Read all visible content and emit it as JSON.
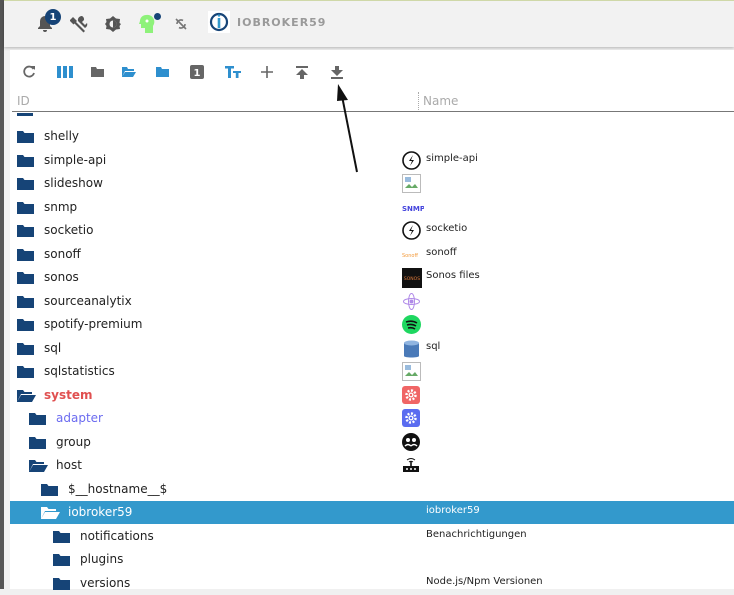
{
  "topbar": {
    "notification_count": "1",
    "host": "IOBROKER59"
  },
  "toolbar": {
    "items": [
      "refresh",
      "columns",
      "folder-closed",
      "folder-open",
      "folder-blue",
      "number-1",
      "text-size",
      "add",
      "upload",
      "download"
    ]
  },
  "header": {
    "id": "ID",
    "name": "Name"
  },
  "rows": [
    {
      "id": "shelly",
      "level": 0,
      "open": false,
      "name": "",
      "icon": ""
    },
    {
      "id": "simple-api",
      "level": 0,
      "open": false,
      "name": "simple-api",
      "icon": "bolt"
    },
    {
      "id": "slideshow",
      "level": 0,
      "open": false,
      "name": "",
      "icon": "broken-image"
    },
    {
      "id": "snmp",
      "level": 0,
      "open": false,
      "name": "",
      "icon": "snmp"
    },
    {
      "id": "socketio",
      "level": 0,
      "open": false,
      "name": "socketio",
      "icon": "bolt"
    },
    {
      "id": "sonoff",
      "level": 0,
      "open": false,
      "name": "sonoff",
      "icon": "sonoff"
    },
    {
      "id": "sonos",
      "level": 0,
      "open": false,
      "name": "Sonos files",
      "icon": "sonos"
    },
    {
      "id": "sourceanalytix",
      "level": 0,
      "open": false,
      "name": "",
      "icon": "atom"
    },
    {
      "id": "spotify-premium",
      "level": 0,
      "open": false,
      "name": "",
      "icon": "spotify"
    },
    {
      "id": "sql",
      "level": 0,
      "open": false,
      "name": "sql",
      "icon": "database"
    },
    {
      "id": "sqlstatistics",
      "level": 0,
      "open": false,
      "name": "",
      "icon": "broken-image"
    },
    {
      "id": "system",
      "level": 0,
      "open": true,
      "name": "",
      "icon": "gear-red",
      "color": "#e05050"
    },
    {
      "id": "adapter",
      "level": 1,
      "open": false,
      "name": "",
      "icon": "gear-blue",
      "color": "#6b6bf0"
    },
    {
      "id": "group",
      "level": 1,
      "open": false,
      "name": "",
      "icon": "group"
    },
    {
      "id": "host",
      "level": 1,
      "open": true,
      "name": "",
      "icon": "router"
    },
    {
      "id": "$__hostname__$",
      "level": 2,
      "open": false,
      "name": "",
      "icon": ""
    },
    {
      "id": "iobroker59",
      "level": 2,
      "open": true,
      "name": "iobroker59",
      "icon": "",
      "selected": true
    },
    {
      "id": "notifications",
      "level": 3,
      "open": false,
      "name": "Benachrichtigungen",
      "icon": ""
    },
    {
      "id": "plugins",
      "level": 3,
      "open": false,
      "name": "",
      "icon": ""
    },
    {
      "id": "versions",
      "level": 3,
      "open": false,
      "name": "Node.js/Npm Versionen",
      "icon": ""
    }
  ],
  "colors": {
    "folder": "#164477",
    "selected": "#3399cc",
    "accent": "#2e8fce"
  }
}
